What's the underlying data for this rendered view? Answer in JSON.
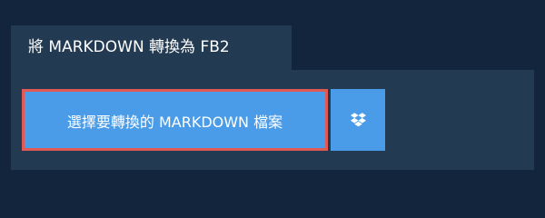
{
  "header": {
    "title": "將 MARKDOWN 轉換為 FB2"
  },
  "upload": {
    "select_label": "選擇要轉換的 MARKDOWN 檔案",
    "dropbox_icon": "dropbox-icon"
  },
  "colors": {
    "background": "#13253c",
    "panel": "#223a52",
    "button": "#4b9ce8",
    "highlight_border": "#e05a55",
    "text": "#ffffff"
  }
}
